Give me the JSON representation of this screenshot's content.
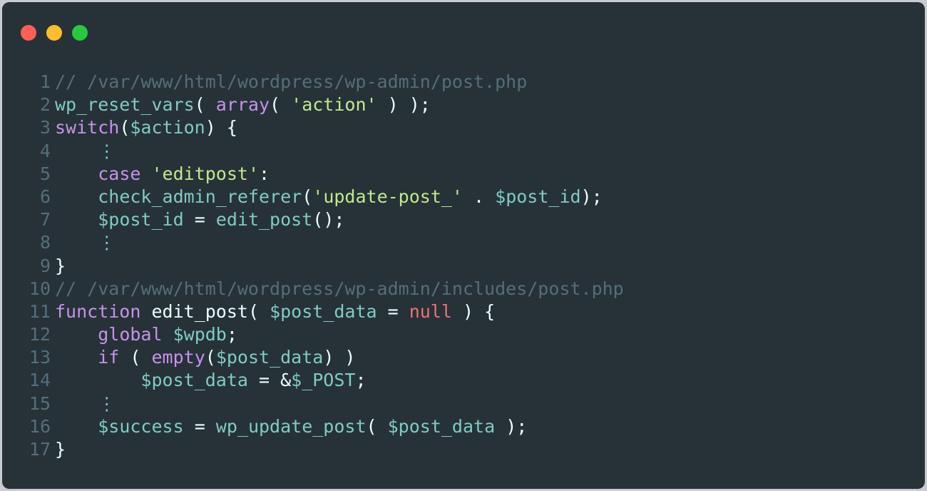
{
  "window": {
    "controls": [
      {
        "name": "close",
        "color": "#ff5f56"
      },
      {
        "name": "minimize",
        "color": "#ffbd2e"
      },
      {
        "name": "maximize",
        "color": "#27c93f"
      }
    ]
  },
  "code": {
    "lines": [
      {
        "n": "1",
        "tokens": [
          {
            "t": "// /var/www/html/wordpress/wp-admin/post.php",
            "c": "comment"
          }
        ]
      },
      {
        "n": "2",
        "tokens": [
          {
            "t": "wp_reset_vars",
            "c": "fn"
          },
          {
            "t": "( ",
            "c": "punc"
          },
          {
            "t": "array",
            "c": "kw"
          },
          {
            "t": "( ",
            "c": "punc"
          },
          {
            "t": "'action'",
            "c": "str"
          },
          {
            "t": " ) );",
            "c": "punc"
          }
        ]
      },
      {
        "n": "3",
        "tokens": [
          {
            "t": "switch",
            "c": "kw"
          },
          {
            "t": "(",
            "c": "punc"
          },
          {
            "t": "$action",
            "c": "var"
          },
          {
            "t": ") {",
            "c": "punc"
          }
        ]
      },
      {
        "n": "4",
        "tokens": [
          {
            "t": "    ",
            "c": "punc"
          },
          {
            "t": "⋮",
            "c": "dots"
          }
        ]
      },
      {
        "n": "5",
        "tokens": [
          {
            "t": "    ",
            "c": "punc"
          },
          {
            "t": "case",
            "c": "kw"
          },
          {
            "t": " ",
            "c": "punc"
          },
          {
            "t": "'editpost'",
            "c": "str"
          },
          {
            "t": ":",
            "c": "punc"
          }
        ]
      },
      {
        "n": "6",
        "tokens": [
          {
            "t": "    ",
            "c": "punc"
          },
          {
            "t": "check_admin_referer",
            "c": "fn"
          },
          {
            "t": "(",
            "c": "punc"
          },
          {
            "t": "'update-post_'",
            "c": "str"
          },
          {
            "t": " . ",
            "c": "punc"
          },
          {
            "t": "$post_id",
            "c": "var"
          },
          {
            "t": ");",
            "c": "punc"
          }
        ]
      },
      {
        "n": "7",
        "tokens": [
          {
            "t": "    ",
            "c": "punc"
          },
          {
            "t": "$post_id",
            "c": "var"
          },
          {
            "t": " = ",
            "c": "punc"
          },
          {
            "t": "edit_post",
            "c": "fn"
          },
          {
            "t": "();",
            "c": "punc"
          }
        ]
      },
      {
        "n": "8",
        "tokens": [
          {
            "t": "    ",
            "c": "punc"
          },
          {
            "t": "⋮",
            "c": "dots"
          }
        ]
      },
      {
        "n": "9",
        "tokens": [
          {
            "t": "}",
            "c": "punc"
          }
        ]
      },
      {
        "n": "10",
        "tokens": [
          {
            "t": "// /var/www/html/wordpress/wp-admin/includes/post.php",
            "c": "comment"
          }
        ]
      },
      {
        "n": "11",
        "tokens": [
          {
            "t": "function",
            "c": "kw"
          },
          {
            "t": " ",
            "c": "punc"
          },
          {
            "t": "edit_post",
            "c": "name"
          },
          {
            "t": "( ",
            "c": "punc"
          },
          {
            "t": "$post_data",
            "c": "var"
          },
          {
            "t": " = ",
            "c": "punc"
          },
          {
            "t": "null",
            "c": "null"
          },
          {
            "t": " ) {",
            "c": "punc"
          }
        ]
      },
      {
        "n": "12",
        "tokens": [
          {
            "t": "    ",
            "c": "punc"
          },
          {
            "t": "global",
            "c": "kw"
          },
          {
            "t": " ",
            "c": "punc"
          },
          {
            "t": "$wpdb",
            "c": "var"
          },
          {
            "t": ";",
            "c": "punc"
          }
        ]
      },
      {
        "n": "13",
        "tokens": [
          {
            "t": "    ",
            "c": "punc"
          },
          {
            "t": "if",
            "c": "kw"
          },
          {
            "t": " ( ",
            "c": "punc"
          },
          {
            "t": "empty",
            "c": "kw"
          },
          {
            "t": "(",
            "c": "punc"
          },
          {
            "t": "$post_data",
            "c": "var"
          },
          {
            "t": ") )",
            "c": "punc"
          }
        ]
      },
      {
        "n": "14",
        "tokens": [
          {
            "t": "        ",
            "c": "punc"
          },
          {
            "t": "$post_data",
            "c": "var"
          },
          {
            "t": " = &",
            "c": "punc"
          },
          {
            "t": "$_POST",
            "c": "var"
          },
          {
            "t": ";",
            "c": "punc"
          }
        ]
      },
      {
        "n": "15",
        "tokens": [
          {
            "t": "    ",
            "c": "punc"
          },
          {
            "t": "⋮",
            "c": "dots"
          }
        ]
      },
      {
        "n": "16",
        "tokens": [
          {
            "t": "    ",
            "c": "punc"
          },
          {
            "t": "$success",
            "c": "var"
          },
          {
            "t": " = ",
            "c": "punc"
          },
          {
            "t": "wp_update_post",
            "c": "fn"
          },
          {
            "t": "( ",
            "c": "punc"
          },
          {
            "t": "$post_data",
            "c": "var"
          },
          {
            "t": " );",
            "c": "punc"
          }
        ]
      },
      {
        "n": "17",
        "tokens": [
          {
            "t": "}",
            "c": "punc"
          }
        ]
      }
    ]
  }
}
